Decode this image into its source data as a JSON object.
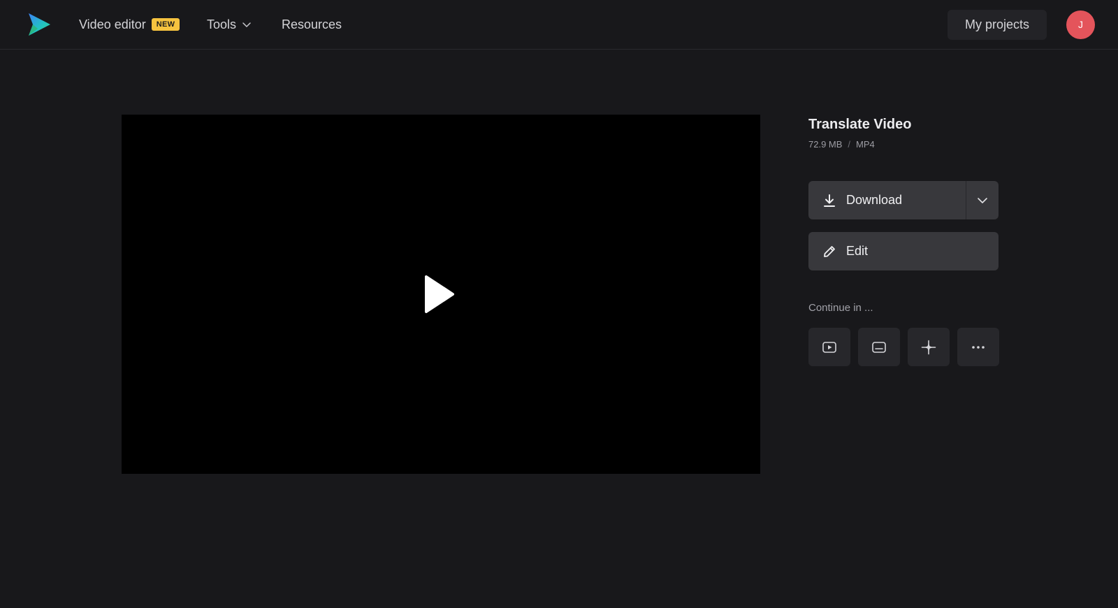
{
  "nav": {
    "video_editor": "Video editor",
    "new_badge": "NEW",
    "tools": "Tools",
    "resources": "Resources",
    "my_projects": "My projects",
    "avatar_initial": "J"
  },
  "video": {
    "title": "Translate Video",
    "size": "72.9 MB",
    "separator": "/",
    "format": "MP4"
  },
  "actions": {
    "download": "Download",
    "edit": "Edit",
    "continue_label": "Continue in ..."
  },
  "continue_tools": [
    {
      "icon": "play-box-icon"
    },
    {
      "icon": "subtitles-icon"
    },
    {
      "icon": "sparkle-icon"
    },
    {
      "icon": "more-icon"
    }
  ],
  "colors": {
    "background": "#18181b",
    "avatar": "#e4545b",
    "badge": "#f6c33f",
    "button": "#38383c"
  }
}
